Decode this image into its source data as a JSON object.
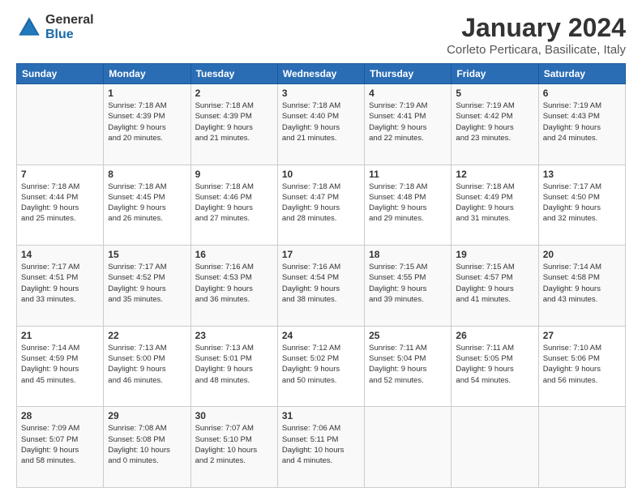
{
  "logo": {
    "general": "General",
    "blue": "Blue"
  },
  "title": "January 2024",
  "subtitle": "Corleto Perticara, Basilicate, Italy",
  "header_days": [
    "Sunday",
    "Monday",
    "Tuesday",
    "Wednesday",
    "Thursday",
    "Friday",
    "Saturday"
  ],
  "weeks": [
    [
      {
        "day": "",
        "content": ""
      },
      {
        "day": "1",
        "content": "Sunrise: 7:18 AM\nSunset: 4:39 PM\nDaylight: 9 hours\nand 20 minutes."
      },
      {
        "day": "2",
        "content": "Sunrise: 7:18 AM\nSunset: 4:39 PM\nDaylight: 9 hours\nand 21 minutes."
      },
      {
        "day": "3",
        "content": "Sunrise: 7:18 AM\nSunset: 4:40 PM\nDaylight: 9 hours\nand 21 minutes."
      },
      {
        "day": "4",
        "content": "Sunrise: 7:19 AM\nSunset: 4:41 PM\nDaylight: 9 hours\nand 22 minutes."
      },
      {
        "day": "5",
        "content": "Sunrise: 7:19 AM\nSunset: 4:42 PM\nDaylight: 9 hours\nand 23 minutes."
      },
      {
        "day": "6",
        "content": "Sunrise: 7:19 AM\nSunset: 4:43 PM\nDaylight: 9 hours\nand 24 minutes."
      }
    ],
    [
      {
        "day": "7",
        "content": "Sunrise: 7:18 AM\nSunset: 4:44 PM\nDaylight: 9 hours\nand 25 minutes."
      },
      {
        "day": "8",
        "content": "Sunrise: 7:18 AM\nSunset: 4:45 PM\nDaylight: 9 hours\nand 26 minutes."
      },
      {
        "day": "9",
        "content": "Sunrise: 7:18 AM\nSunset: 4:46 PM\nDaylight: 9 hours\nand 27 minutes."
      },
      {
        "day": "10",
        "content": "Sunrise: 7:18 AM\nSunset: 4:47 PM\nDaylight: 9 hours\nand 28 minutes."
      },
      {
        "day": "11",
        "content": "Sunrise: 7:18 AM\nSunset: 4:48 PM\nDaylight: 9 hours\nand 29 minutes."
      },
      {
        "day": "12",
        "content": "Sunrise: 7:18 AM\nSunset: 4:49 PM\nDaylight: 9 hours\nand 31 minutes."
      },
      {
        "day": "13",
        "content": "Sunrise: 7:17 AM\nSunset: 4:50 PM\nDaylight: 9 hours\nand 32 minutes."
      }
    ],
    [
      {
        "day": "14",
        "content": "Sunrise: 7:17 AM\nSunset: 4:51 PM\nDaylight: 9 hours\nand 33 minutes."
      },
      {
        "day": "15",
        "content": "Sunrise: 7:17 AM\nSunset: 4:52 PM\nDaylight: 9 hours\nand 35 minutes."
      },
      {
        "day": "16",
        "content": "Sunrise: 7:16 AM\nSunset: 4:53 PM\nDaylight: 9 hours\nand 36 minutes."
      },
      {
        "day": "17",
        "content": "Sunrise: 7:16 AM\nSunset: 4:54 PM\nDaylight: 9 hours\nand 38 minutes."
      },
      {
        "day": "18",
        "content": "Sunrise: 7:15 AM\nSunset: 4:55 PM\nDaylight: 9 hours\nand 39 minutes."
      },
      {
        "day": "19",
        "content": "Sunrise: 7:15 AM\nSunset: 4:57 PM\nDaylight: 9 hours\nand 41 minutes."
      },
      {
        "day": "20",
        "content": "Sunrise: 7:14 AM\nSunset: 4:58 PM\nDaylight: 9 hours\nand 43 minutes."
      }
    ],
    [
      {
        "day": "21",
        "content": "Sunrise: 7:14 AM\nSunset: 4:59 PM\nDaylight: 9 hours\nand 45 minutes."
      },
      {
        "day": "22",
        "content": "Sunrise: 7:13 AM\nSunset: 5:00 PM\nDaylight: 9 hours\nand 46 minutes."
      },
      {
        "day": "23",
        "content": "Sunrise: 7:13 AM\nSunset: 5:01 PM\nDaylight: 9 hours\nand 48 minutes."
      },
      {
        "day": "24",
        "content": "Sunrise: 7:12 AM\nSunset: 5:02 PM\nDaylight: 9 hours\nand 50 minutes."
      },
      {
        "day": "25",
        "content": "Sunrise: 7:11 AM\nSunset: 5:04 PM\nDaylight: 9 hours\nand 52 minutes."
      },
      {
        "day": "26",
        "content": "Sunrise: 7:11 AM\nSunset: 5:05 PM\nDaylight: 9 hours\nand 54 minutes."
      },
      {
        "day": "27",
        "content": "Sunrise: 7:10 AM\nSunset: 5:06 PM\nDaylight: 9 hours\nand 56 minutes."
      }
    ],
    [
      {
        "day": "28",
        "content": "Sunrise: 7:09 AM\nSunset: 5:07 PM\nDaylight: 9 hours\nand 58 minutes."
      },
      {
        "day": "29",
        "content": "Sunrise: 7:08 AM\nSunset: 5:08 PM\nDaylight: 10 hours\nand 0 minutes."
      },
      {
        "day": "30",
        "content": "Sunrise: 7:07 AM\nSunset: 5:10 PM\nDaylight: 10 hours\nand 2 minutes."
      },
      {
        "day": "31",
        "content": "Sunrise: 7:06 AM\nSunset: 5:11 PM\nDaylight: 10 hours\nand 4 minutes."
      },
      {
        "day": "",
        "content": ""
      },
      {
        "day": "",
        "content": ""
      },
      {
        "day": "",
        "content": ""
      }
    ]
  ]
}
